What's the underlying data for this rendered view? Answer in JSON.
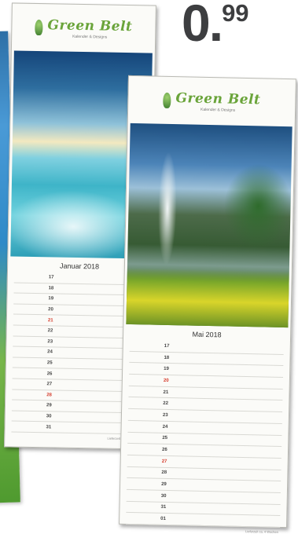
{
  "price": {
    "integer": "0",
    "separator": ".",
    "cents": "99"
  },
  "brand": {
    "name": "Green Belt",
    "tagline": "Kalender & Designs"
  },
  "calendars": {
    "back": {
      "month": "Januar 2018",
      "days": [
        "17",
        "18",
        "19",
        "20",
        "21",
        "22",
        "23",
        "24",
        "25",
        "26",
        "27",
        "28",
        "29",
        "30",
        "31"
      ],
      "sundays": [
        "21",
        "28"
      ],
      "footer": "Lieferzeit ca. 4 Wochen"
    },
    "front": {
      "month": "Mai 2018",
      "days": [
        "17",
        "18",
        "19",
        "20",
        "21",
        "22",
        "23",
        "24",
        "25",
        "26",
        "27",
        "28",
        "29",
        "30",
        "31",
        "01"
      ],
      "sundays": [
        "20",
        "27"
      ],
      "footer": "Lieferzeit ca. 4 Wochen"
    }
  }
}
